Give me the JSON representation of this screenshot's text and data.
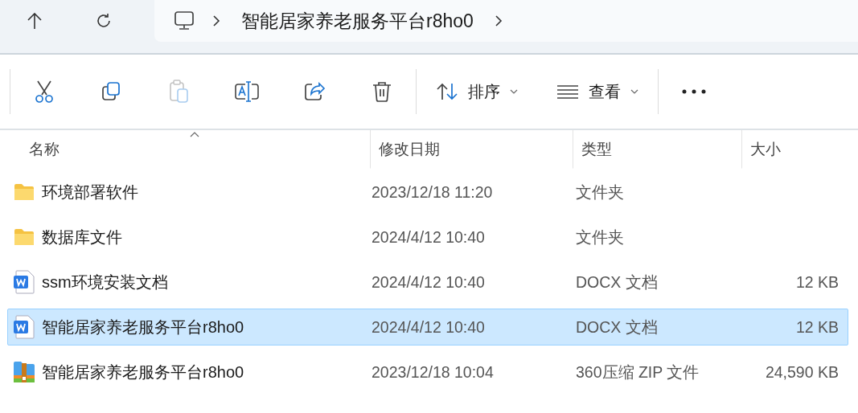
{
  "navigation": {
    "buttons": [
      {
        "kind": "up"
      },
      {
        "kind": "refresh"
      }
    ],
    "breadcrumb": [
      {
        "kind": "computer"
      },
      {
        "kind": "folder",
        "label": "智能居家养老服务平台r8ho0"
      }
    ]
  },
  "toolbar": {
    "items": [
      {
        "kind": "cut"
      },
      {
        "kind": "copy"
      },
      {
        "kind": "paste",
        "disabled": true
      },
      {
        "kind": "rename"
      },
      {
        "kind": "share"
      },
      {
        "kind": "delete"
      },
      {
        "kind": "sort",
        "label": "排序"
      },
      {
        "kind": "view",
        "label": "查看"
      },
      {
        "kind": "more"
      }
    ]
  },
  "file_list": {
    "columns": [
      {
        "label": "名称",
        "sorted": true
      },
      {
        "label": "修改日期",
        "sorted": false
      },
      {
        "label": "类型",
        "sorted": false
      },
      {
        "label": "大小",
        "sorted": false
      }
    ],
    "rows": [
      {
        "kind": "folder",
        "name": "环境部署软件",
        "date": "2023/12/18 11:20",
        "type": "文件夹",
        "selected": false
      },
      {
        "kind": "folder",
        "name": "数据库文件",
        "date": "2024/4/12 10:40",
        "type": "文件夹",
        "selected": false
      },
      {
        "kind": "document",
        "name": "ssm环境安装文档",
        "date": "2024/4/12 10:40",
        "type": "DOCX 文档",
        "size": "12 KB",
        "selected": false
      },
      {
        "kind": "document",
        "name": "智能居家养老服务平台r8ho0",
        "date": "2024/4/12 10:40",
        "type": "DOCX 文档",
        "size": "12 KB",
        "selected": true
      },
      {
        "kind": "archive",
        "name": "智能居家养老服务平台r8ho0",
        "date": "2023/12/18 10:04",
        "type": "360压缩 ZIP 文件",
        "size": "24,590 KB",
        "selected": false
      }
    ]
  }
}
